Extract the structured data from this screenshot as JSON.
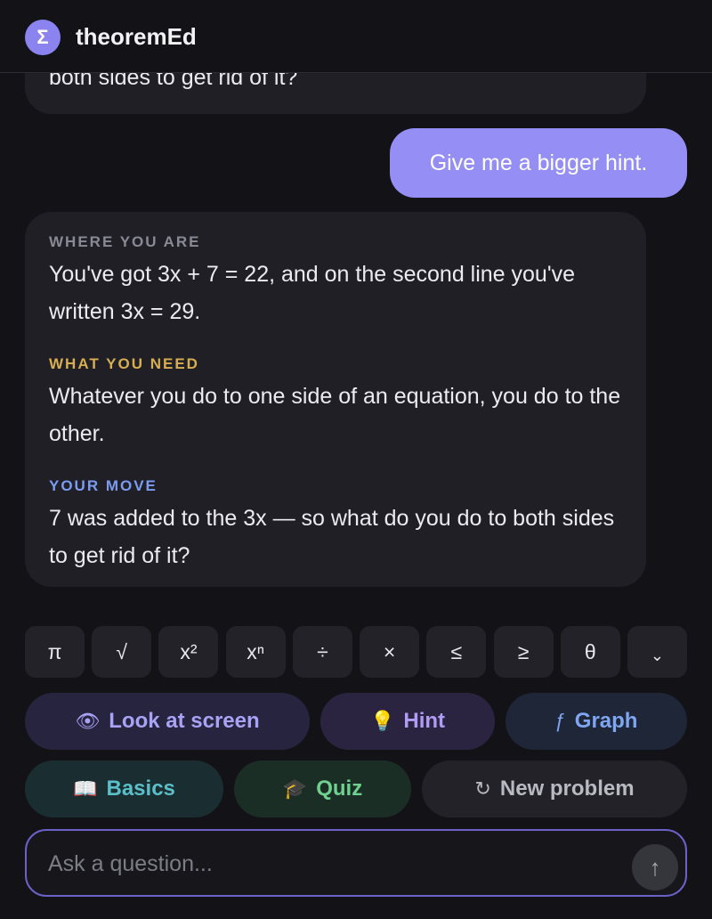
{
  "header": {
    "logo_glyph": "Σ",
    "app_name": "theoremEd"
  },
  "chat": {
    "previous_ai_tail": "both sides to get rid of it?",
    "user_message": "Give me a bigger hint.",
    "ai_response": {
      "where_label": "WHERE YOU ARE",
      "where_text": "You've got 3x + 7 = 22, and on the second line you've written 3x = 29.",
      "need_label": "WHAT YOU NEED",
      "need_text": "Whatever you do to one side of an equation, you do to the other.",
      "move_label": "YOUR MOVE",
      "move_text": "7 was added to the 3x — so what do you do to both sides to get rid of it?"
    }
  },
  "math_keys": [
    "π",
    "√",
    "x²",
    "xⁿ",
    "÷",
    "×",
    "≤",
    "≥",
    "θ",
    "⌄"
  ],
  "actions": {
    "look": {
      "icon": "👁",
      "label": "Look at screen"
    },
    "hint": {
      "icon": "💡",
      "label": "Hint"
    },
    "graph": {
      "icon": "ƒ",
      "label": "Graph"
    },
    "basics": {
      "icon": "📖",
      "label": "Basics"
    },
    "quiz": {
      "icon": "🎓",
      "label": "Quiz"
    },
    "new_problem": {
      "icon": "↻",
      "label": "New problem"
    }
  },
  "composer": {
    "placeholder": "Ask a question...",
    "send_icon": "↑"
  },
  "colors": {
    "accent": "#958ff5",
    "background": "#121217",
    "bubble": "#1f1f25",
    "where": "#8a8a96",
    "need": "#d9ae52",
    "move": "#7c9cf2"
  }
}
